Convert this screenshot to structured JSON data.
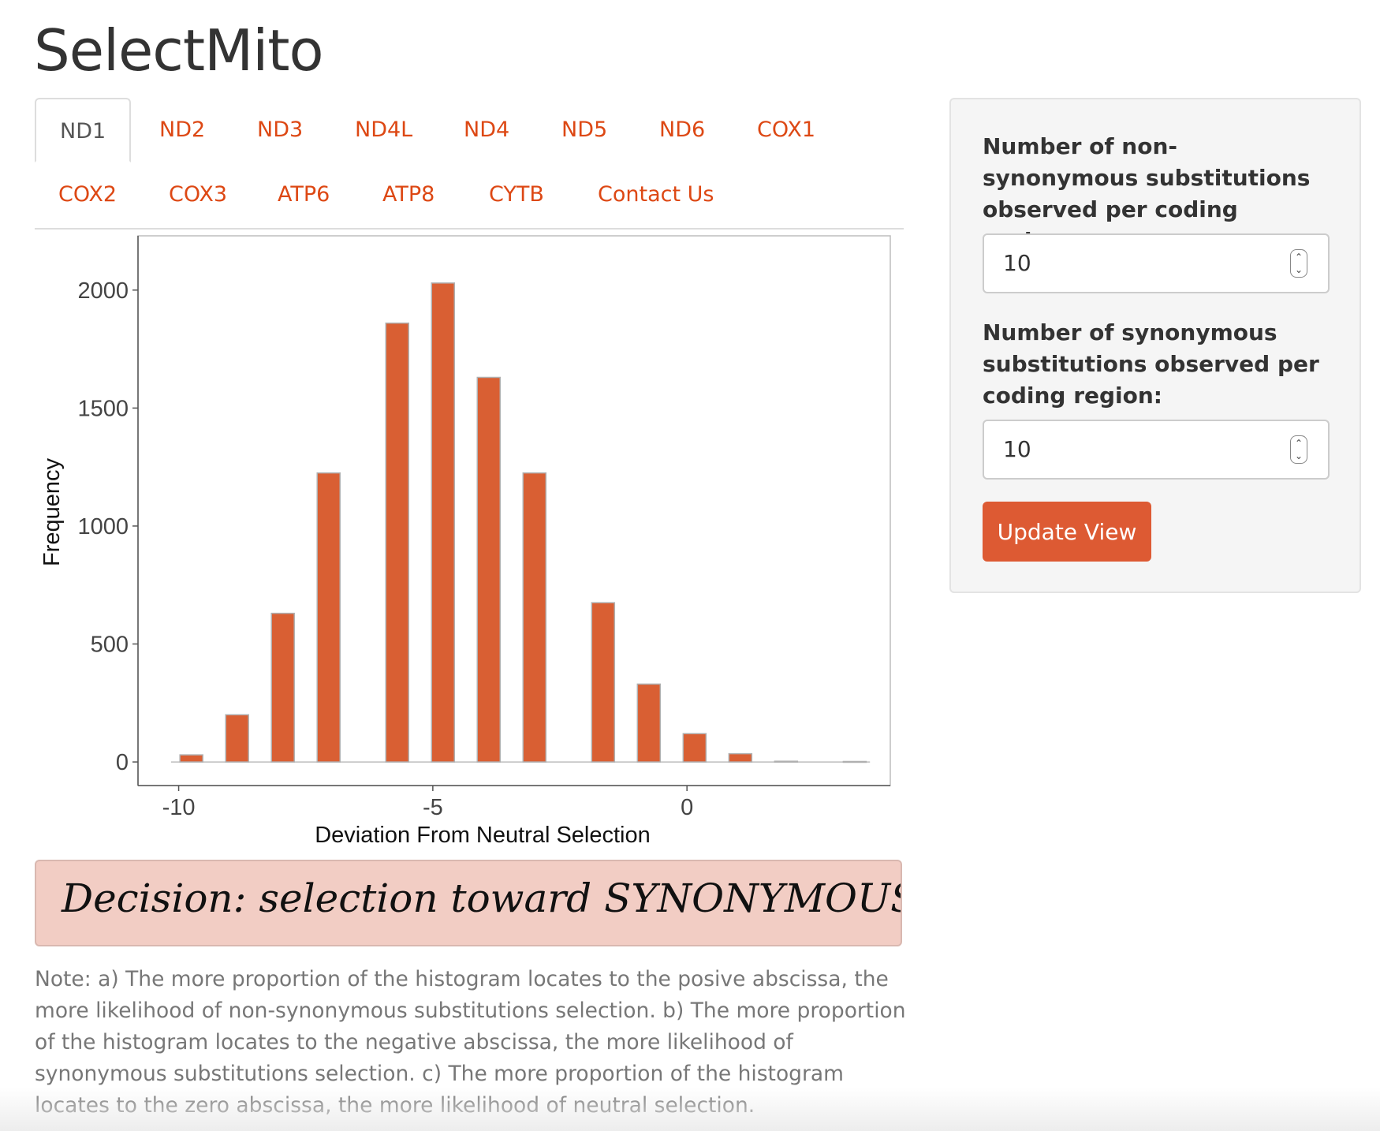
{
  "app": {
    "title": "SelectMito"
  },
  "tabs": [
    {
      "label": "ND1",
      "active": true
    },
    {
      "label": "ND2"
    },
    {
      "label": "ND3"
    },
    {
      "label": "ND4L"
    },
    {
      "label": "ND4"
    },
    {
      "label": "ND5"
    },
    {
      "label": "ND6"
    },
    {
      "label": "COX1"
    },
    {
      "label": "COX2"
    },
    {
      "label": "COX3"
    },
    {
      "label": "ATP6"
    },
    {
      "label": "ATP8"
    },
    {
      "label": "CYTB"
    },
    {
      "label": "Contact Us"
    }
  ],
  "colors": {
    "accent": "#dd4814",
    "bar_fill": "#d95f33",
    "bar_stroke": "#b0b0b0",
    "decision_bg": "#f2cdc4",
    "panel_bg": "#f5f5f5"
  },
  "chart_data": {
    "type": "bar",
    "xlabel": "Deviation From Neutral Selection",
    "ylabel": "Frequency",
    "x_ticks": [
      "-10",
      "-5",
      "0"
    ],
    "x_tick_values": [
      -10,
      -5,
      0
    ],
    "y_ticks": [
      "0",
      "500",
      "1000",
      "1500",
      "2000"
    ],
    "y_tick_values": [
      0,
      500,
      1000,
      1500,
      2000
    ],
    "xlim": [
      -10.8,
      4
    ],
    "ylim": [
      -100,
      2230
    ],
    "bars": [
      {
        "x": -9.75,
        "value": 30
      },
      {
        "x": -8.85,
        "value": 200
      },
      {
        "x": -7.95,
        "value": 630
      },
      {
        "x": -7.05,
        "value": 1225
      },
      {
        "x": -5.7,
        "value": 1860
      },
      {
        "x": -4.8,
        "value": 2030
      },
      {
        "x": -3.9,
        "value": 1630
      },
      {
        "x": -3.0,
        "value": 1225
      },
      {
        "x": -1.65,
        "value": 675
      },
      {
        "x": -0.75,
        "value": 330
      },
      {
        "x": 0.15,
        "value": 120
      },
      {
        "x": 1.05,
        "value": 35
      },
      {
        "x": 1.95,
        "value": 3
      },
      {
        "x": 3.3,
        "value": 2
      }
    ],
    "grid": false
  },
  "decision": {
    "text": "Decision: selection toward SYNONYMOUS substitutions"
  },
  "note": {
    "text": "Note: a) The more proportion of the histogram locates to the posive abscissa, the more likelihood of non-synonymous substitutions selection. b) The more proportion of the histogram locates to the negative abscissa, the more likelihood of synonymous substitutions selection. c) The more proportion of the histogram locates to the zero abscissa, the more likelihood of neutral selection."
  },
  "sidebar": {
    "nonsyn_label": "Number of non-synonymous substitutions observed per coding region:",
    "nonsyn_value": "10",
    "syn_label": "Number of synonymous substitutions observed per coding region:",
    "syn_value": "10",
    "update_label": "Update View"
  },
  "icons": {
    "spinner": "spinner-arrows-icon"
  }
}
